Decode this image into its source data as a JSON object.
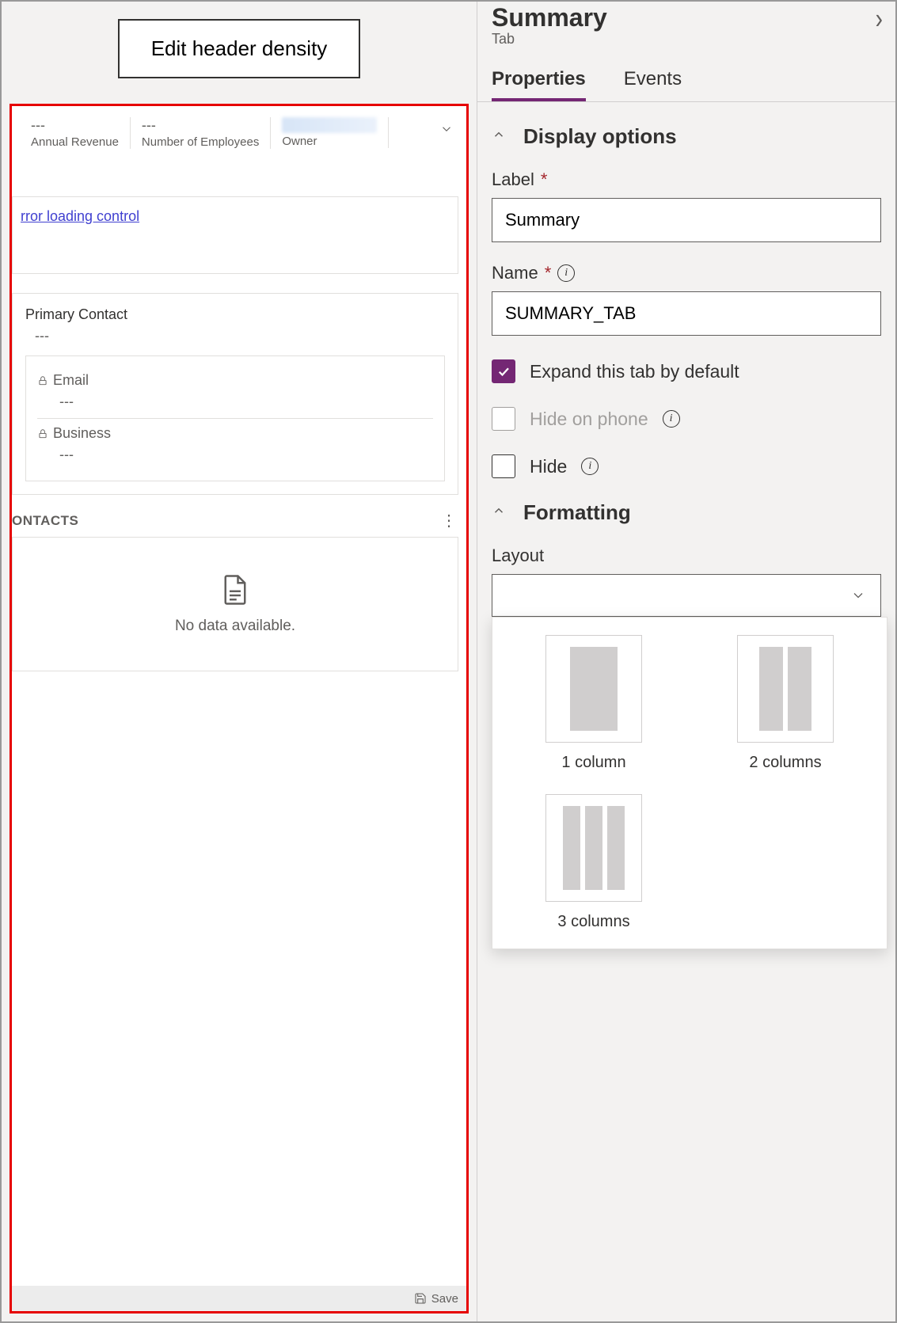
{
  "left": {
    "edit_header_btn": "Edit header density",
    "header_fields": {
      "annual_revenue": {
        "value": "---",
        "label": "Annual Revenue"
      },
      "num_employees": {
        "value": "---",
        "label": "Number of Employees"
      },
      "owner": {
        "label": "Owner"
      }
    },
    "error_link": "rror loading control",
    "primary_contact": {
      "label": "Primary Contact",
      "value": "---"
    },
    "email": {
      "label": "Email",
      "value": "---"
    },
    "business": {
      "label": "Business",
      "value": "---"
    },
    "contacts_title": "ONTACTS",
    "no_data": "No data available.",
    "save": "Save"
  },
  "right": {
    "title": "Summary",
    "subtitle": "Tab",
    "tabs": {
      "properties": "Properties",
      "events": "Events"
    },
    "display_options": {
      "title": "Display options",
      "label_label": "Label",
      "label_value": "Summary",
      "name_label": "Name",
      "name_value": "SUMMARY_TAB",
      "expand": "Expand this tab by default",
      "hide_phone": "Hide on phone",
      "hide": "Hide"
    },
    "formatting": {
      "title": "Formatting",
      "layout_label": "Layout",
      "options": {
        "one": "1 column",
        "two": "2 columns",
        "three": "3 columns"
      }
    }
  }
}
